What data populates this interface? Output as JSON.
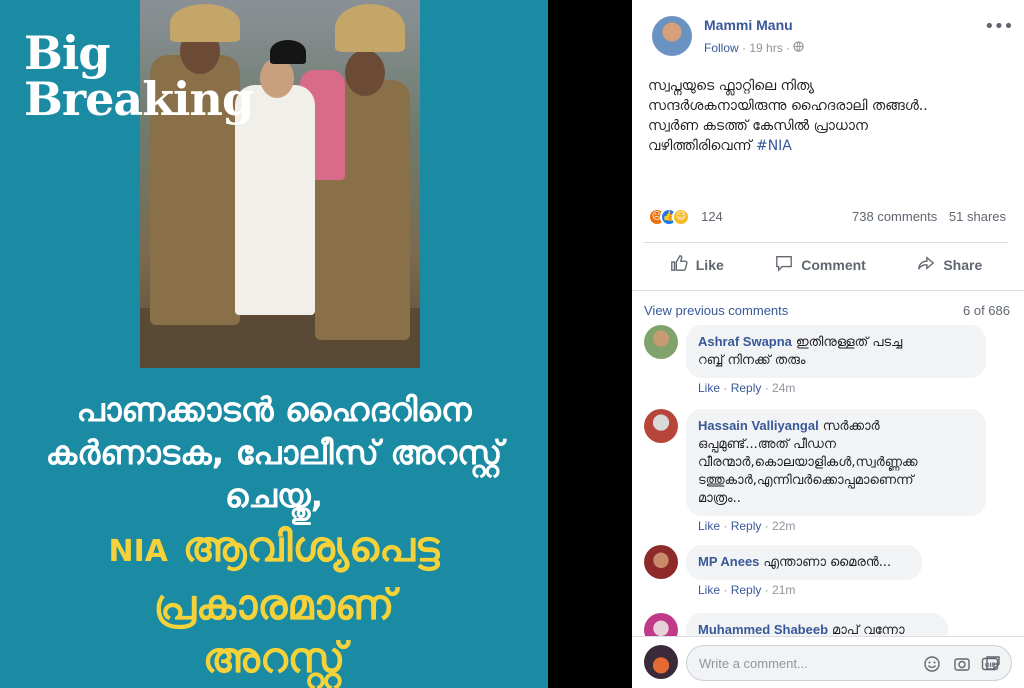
{
  "media": {
    "big_breaking_line1": "Big",
    "big_breaking_line2": "Breaking",
    "headline_line1": "പാണക്കാടൻ ഹൈദറിനെ",
    "headline_line2": "കർണാടക, പോലീസ് അറസ്റ്റ്",
    "headline_line3": "ചെയ്തു,",
    "sub_nia": "NIA",
    "sub_line1": "ആവിശ്യപെട്ട",
    "sub_line2": "പ്രകാരമാണ്",
    "sub_line3": "അറസ്റ്റ്"
  },
  "post": {
    "author": "Mammi Manu",
    "follow": "Follow",
    "time": "19 hrs",
    "text_line1": "സ്വപ്നയുടെ ഫ്ലാറ്റിലെ നിത്യ",
    "text_line2": "സന്ദർശകനായിരുന്നു ഹൈദരാലി തങ്ങൾ..",
    "text_line3": "സ്വർണ കടത്ത് കേസിൽ പ്രാധാന",
    "text_line4": "വഴിത്തിരിവെന്ന്",
    "hashtag": "#NIA",
    "reaction_count": "124",
    "comments_count": "738 comments",
    "shares_count": "51 shares",
    "like_label": "Like",
    "comment_label": "Comment",
    "share_label": "Share"
  },
  "comments": {
    "view_previous": "View previous comments",
    "position": "6 of 686",
    "items": [
      {
        "author": "Ashraf Swapna",
        "text_line1": "ഇതിനുള്ളത് പടച്ച",
        "text_line2": "റബ്ബ് നിനക്ക് തരും",
        "like": "Like",
        "reply": "Reply",
        "time": "24m"
      },
      {
        "author": "Hassain Valliyangal",
        "text_line1": "സർക്കാർ",
        "text_line2": "ഒപ്പമുണ്ട്...അത് പീഡന",
        "text_line3": "വീരന്മാർ,കൊലയാളികൾ,സ്വർണ്ണക്ക",
        "text_line4": "ടത്തുകാർ,എന്നിവർക്കൊപ്പമാണെന്ന്",
        "text_line5": "മാത്രം..",
        "like": "Like",
        "reply": "Reply",
        "time": "22m"
      },
      {
        "author": "MP Anees",
        "text_line1": "എന്താണാ മൈരൻ...",
        "like": "Like",
        "reply": "Reply",
        "time": "21m"
      },
      {
        "author": "Muhammed Shabeeb",
        "text_line1": "മാപ് വന്നോ"
      }
    ]
  },
  "composer": {
    "placeholder": "Write a comment..."
  },
  "icons": {
    "more": "more-horizontal-icon",
    "globe": "globe-icon",
    "like": "thumbs-up-icon",
    "comment": "speech-bubble-icon",
    "share": "share-arrow-icon",
    "emoji": "emoji-icon",
    "camera": "camera-icon",
    "gif": "gif-icon",
    "sticker": "sticker-icon"
  },
  "colors": {
    "poster_bg": "#1a8ba3",
    "headline_yellow": "#f6d23a",
    "fb_link": "#385898",
    "angry": "#e9710f",
    "like": "#1877f2",
    "haha": "#f7b928"
  }
}
